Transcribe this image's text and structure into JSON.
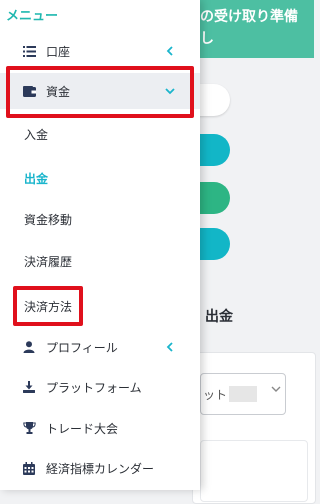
{
  "background": {
    "banner_text": "の受け取り準備\nし",
    "section_title": "出金",
    "select_text": "ット"
  },
  "drawer": {
    "title": "メニュー",
    "items": [
      {
        "label": "口座",
        "icon": "list-icon"
      },
      {
        "label": "資金",
        "icon": "wallet-icon"
      },
      {
        "label": "プロフィール",
        "icon": "user-icon"
      },
      {
        "label": "プラットフォーム",
        "icon": "download-icon"
      },
      {
        "label": "トレード大会",
        "icon": "trophy-icon"
      },
      {
        "label": "経済指標カレンダー",
        "icon": "calendar-icon"
      }
    ],
    "funds_submenu": [
      {
        "label": "入金"
      },
      {
        "label": "出金",
        "current": true
      },
      {
        "label": "資金移動"
      },
      {
        "label": "決済履歴"
      },
      {
        "label": "決済方法"
      }
    ]
  },
  "colors": {
    "accent": "#1ab5cc",
    "header_green": "#4dbfa2",
    "highlight_red": "#e0101c",
    "icon_navy": "#2c3a5a"
  }
}
